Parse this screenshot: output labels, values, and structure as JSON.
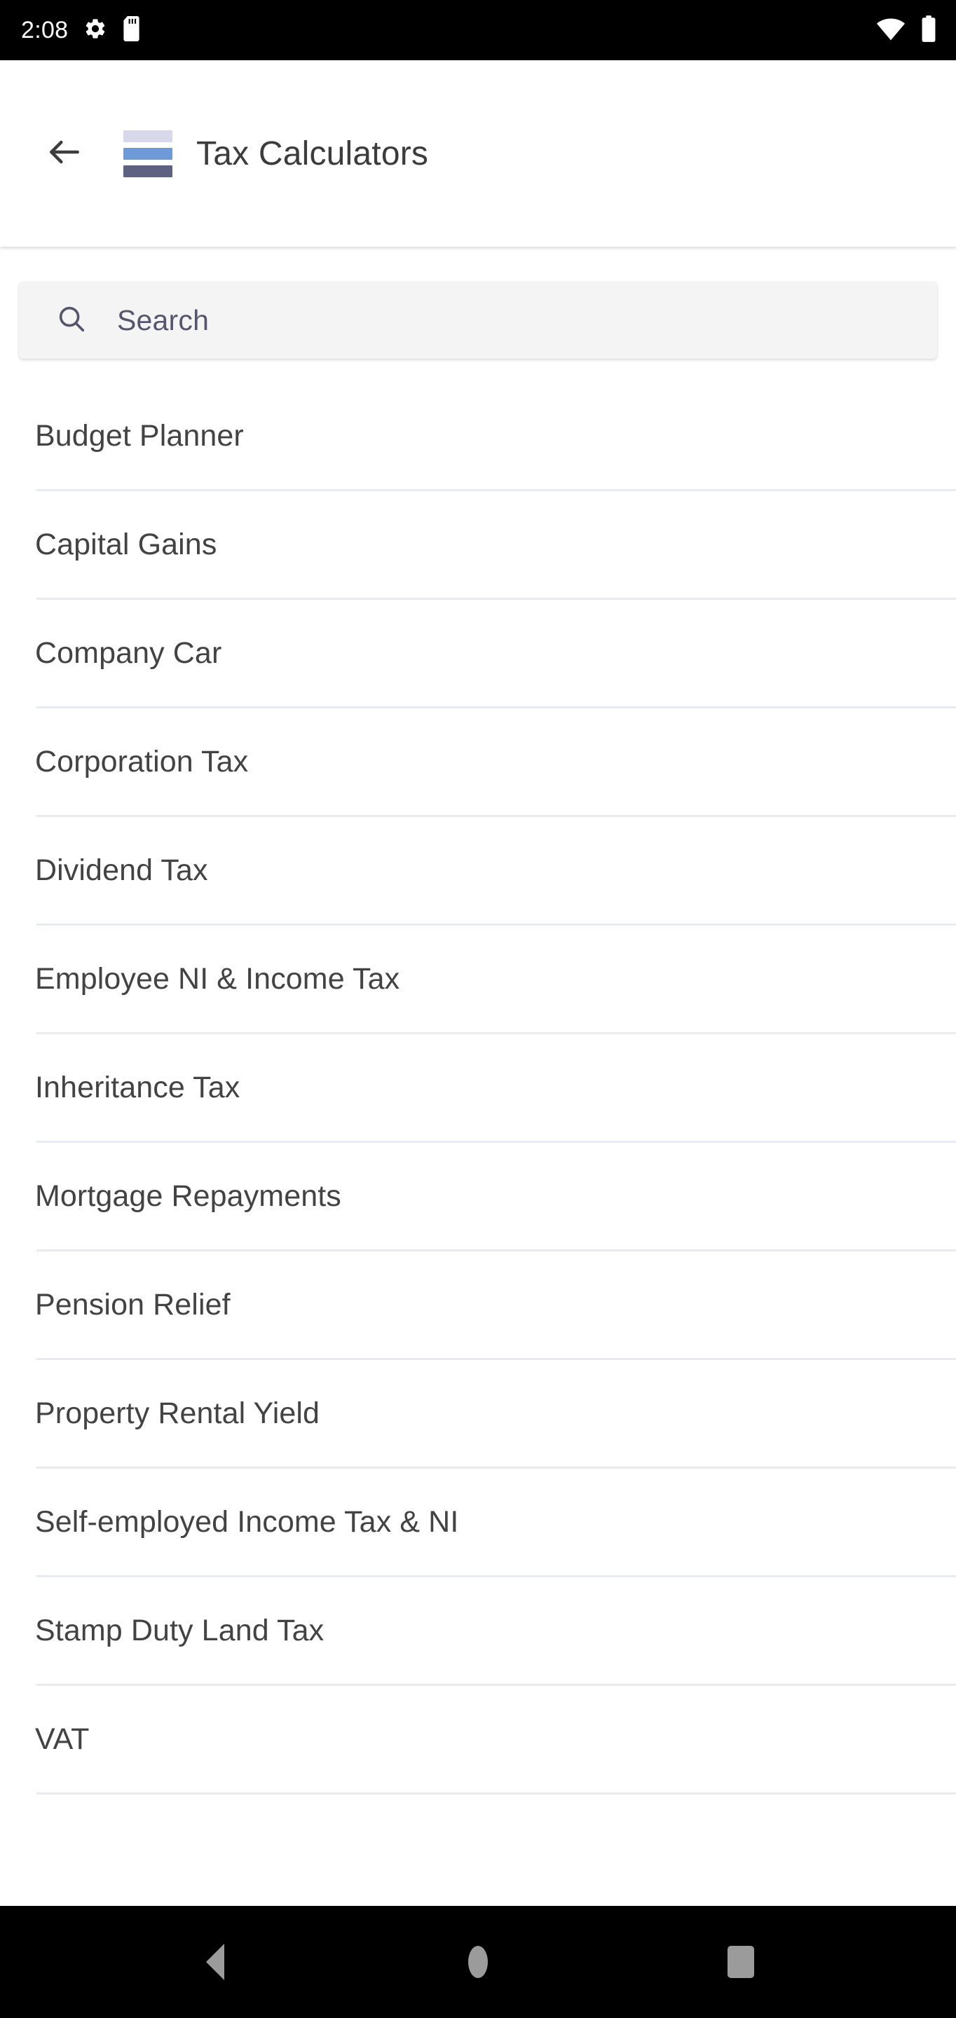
{
  "status_bar": {
    "clock": "2:08",
    "left_icons": [
      "gear-icon",
      "sd-card-icon"
    ],
    "right_icons": [
      "wifi-icon",
      "battery-icon"
    ],
    "background_color": "#000000",
    "foreground_color": "#ffffff"
  },
  "app_bar": {
    "back_label": "Back",
    "title": "Tax Calculators",
    "logo": {
      "name": "tax-calculators-logo",
      "bar_colors": [
        "#d7d8e9",
        "#6f9ad8",
        "#5f6180"
      ]
    },
    "background_color": "#ffffff",
    "title_color": "#3c3c3c"
  },
  "search": {
    "placeholder": "Search",
    "value": "",
    "icon": "search-icon",
    "background_color": "#f4f4f4",
    "text_color": "#55566e"
  },
  "calculator_list": {
    "divider_color": "#e9ebf2",
    "text_color": "#434343",
    "items": [
      {
        "label": "Budget Planner"
      },
      {
        "label": "Capital Gains"
      },
      {
        "label": "Company Car"
      },
      {
        "label": "Corporation Tax"
      },
      {
        "label": "Dividend Tax"
      },
      {
        "label": "Employee NI & Income Tax"
      },
      {
        "label": "Inheritance Tax"
      },
      {
        "label": "Mortgage Repayments"
      },
      {
        "label": "Pension Relief"
      },
      {
        "label": "Property Rental Yield"
      },
      {
        "label": "Self-employed Income Tax & NI"
      },
      {
        "label": "Stamp Duty Land Tax"
      },
      {
        "label": "VAT"
      }
    ]
  },
  "nav_bar": {
    "background_color": "#000000",
    "icon_color": "#9b9b9b",
    "buttons": [
      {
        "name": "back",
        "label": "Back"
      },
      {
        "name": "home",
        "label": "Home"
      },
      {
        "name": "recents",
        "label": "Recents"
      }
    ]
  }
}
